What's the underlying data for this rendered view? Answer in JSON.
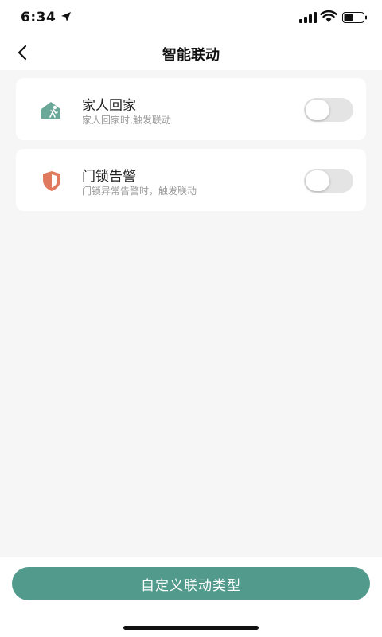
{
  "status_bar": {
    "time": "6:34",
    "icons": [
      "location-arrow-icon",
      "cellular-signal-icon",
      "wifi-icon",
      "battery-icon"
    ]
  },
  "nav": {
    "title": "智能联动",
    "back_icon": "chevron-left-icon"
  },
  "linkages": [
    {
      "title": "家人回家",
      "subtitle": "家人回家时,触发联动",
      "icon": "home-arrival-icon",
      "enabled": false
    },
    {
      "title": "门锁告警",
      "subtitle": "门锁异常告警时，触发联动",
      "icon": "shield-icon",
      "enabled": false
    }
  ],
  "footer": {
    "custom_button_label": "自定义联动类型"
  },
  "colors": {
    "accent": "#519a8c",
    "home_icon": "#6aa89a",
    "shield_icon": "#e07a5f",
    "background": "#f6f6f6",
    "toggle_off": "#e4e4e4"
  }
}
